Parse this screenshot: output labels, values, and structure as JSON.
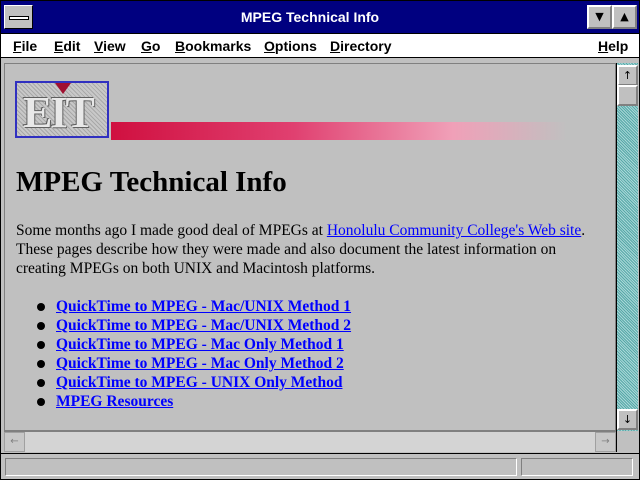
{
  "window": {
    "title": "MPEG Technical Info",
    "minimize_glyph": "▼",
    "maximize_glyph": "▲"
  },
  "menubar": {
    "items": [
      {
        "label": "File",
        "hotkey": "F"
      },
      {
        "label": "Edit",
        "hotkey": "E"
      },
      {
        "label": "View",
        "hotkey": "V"
      },
      {
        "label": "Go",
        "hotkey": "G"
      },
      {
        "label": "Bookmarks",
        "hotkey": "B"
      },
      {
        "label": "Options",
        "hotkey": "O"
      },
      {
        "label": "Directory",
        "hotkey": "D"
      },
      {
        "label": "Help",
        "hotkey": "H"
      }
    ]
  },
  "page": {
    "logo_text": "EIT",
    "heading": "MPEG Technical Info",
    "intro_before_link": "Some months ago I made good deal of MPEGs at ",
    "intro_link": "Honolulu Community College's Web site",
    "intro_after_link": ". These pages describe how they were made and also document the latest information on creating MPEGs on both UNIX and Macintosh platforms.",
    "links": [
      "QuickTime to MPEG - Mac/UNIX Method 1",
      "QuickTime to MPEG - Mac/UNIX Method 2",
      "QuickTime to MPEG - Mac Only Method 1",
      "QuickTime to MPEG - Mac Only Method 2",
      "QuickTime to MPEG - UNIX Only Method",
      "MPEG Resources"
    ]
  },
  "scrollbar": {
    "up_glyph": "↑",
    "down_glyph": "↓",
    "left_glyph": "←",
    "right_glyph": "→"
  },
  "status": {
    "text": ""
  },
  "colors": {
    "titlebar": "#000080",
    "link": "#0000ff",
    "background": "#c0c0c0",
    "accent_bar": "#d01040"
  }
}
